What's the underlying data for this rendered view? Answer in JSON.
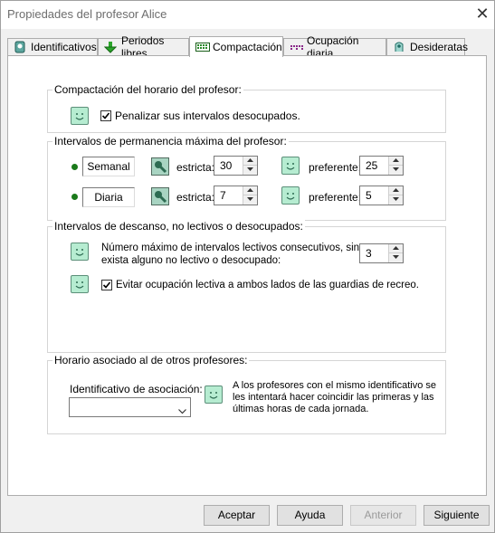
{
  "window": {
    "title": "Propiedades del profesor Alice",
    "close_glyph": "✕"
  },
  "tabs": [
    {
      "label": "Identificativos",
      "icon": "id-card-icon"
    },
    {
      "label": "Periodos libres",
      "icon": "green-arrow-down-icon"
    },
    {
      "label": "Compactación",
      "icon": "compact-grid-icon",
      "active": true
    },
    {
      "label": "Ocupación diaria",
      "icon": "daily-dots-icon"
    },
    {
      "label": "Desideratas",
      "icon": "desiderata-icon"
    }
  ],
  "compactacion": {
    "title": "Compactación del horario del profesor:",
    "penalizar_label": "Penalizar sus intervalos desocupados.",
    "penalizar_checked": true
  },
  "permanencia": {
    "title": "Intervalos de permanencia máxima del profesor:",
    "rows": [
      {
        "name": "Semanal",
        "estricta_label": "estricta:",
        "estricta": "30",
        "preferente_label": "preferente:",
        "preferente": "25"
      },
      {
        "name": "Diaria",
        "estricta_label": "estricta:",
        "estricta": "7",
        "preferente_label": "preferente:",
        "preferente": "5"
      }
    ]
  },
  "descanso": {
    "title": "Intervalos de descanso, no lectivos o desocupados:",
    "max_consecutivos_label_1": "Número máximo de intervalos lectivos consecutivos, sin que",
    "max_consecutivos_label_2": "exista alguno no lectivo o desocupado:",
    "max_consecutivos": "3",
    "evitar_label": "Evitar ocupación lectiva a ambos lados de las guardias de recreo.",
    "evitar_checked": true
  },
  "asociado": {
    "title": "Horario asociado al de otros profesores:",
    "identificativo_label": "Identificativo de asociación:",
    "identificativo_value": "",
    "desc_1": "A los profesores con el mismo identificativo se",
    "desc_2": "les intentará hacer coincidir las primeras y las",
    "desc_3": "últimas horas de cada jornada."
  },
  "buttons": {
    "aceptar": "Aceptar",
    "ayuda": "Ayuda",
    "anterior": "Anterior",
    "siguiente": "Siguiente"
  }
}
